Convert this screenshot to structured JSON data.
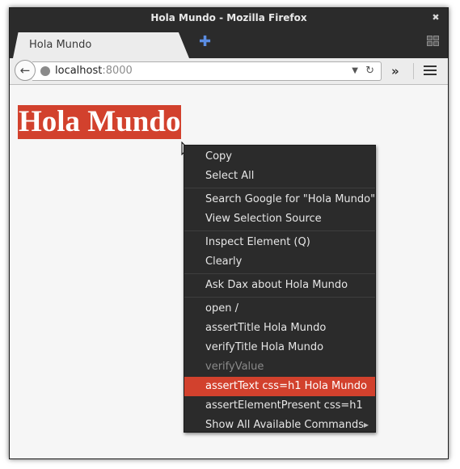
{
  "window": {
    "title": "Hola Mundo - Mozilla Firefox",
    "close_glyph": "✖"
  },
  "tab": {
    "label": "Hola Mundo",
    "new_tab_glyph": "✚"
  },
  "navbar": {
    "url_host": "localhost",
    "url_port": ":8000",
    "back_glyph": "←",
    "drop_glyph": "▼",
    "reload_glyph": "↻",
    "overflow_glyph": "»"
  },
  "page": {
    "heading": "Hola Mundo"
  },
  "context_menu": {
    "copy": "Copy",
    "select_all": "Select All",
    "search_google": "Search Google for \"Hola Mundo\"",
    "view_source": "View Selection Source",
    "inspect": "Inspect Element (Q)",
    "clearly": "Clearly",
    "ask_dax": "Ask Dax about Hola Mundo",
    "open": "open /",
    "assert_title": "assertTitle Hola Mundo",
    "verify_title": "verifyTitle Hola Mundo",
    "verify_value": "verifyValue",
    "assert_text": "assertText css=h1 Hola Mundo",
    "assert_element": "assertElementPresent css=h1",
    "show_all": "Show All Available Commands",
    "submenu_glyph": "▶"
  },
  "colors": {
    "accent": "#d2412d",
    "menu_bg": "#2b2b2b",
    "chrome": "#2b2b2b"
  }
}
